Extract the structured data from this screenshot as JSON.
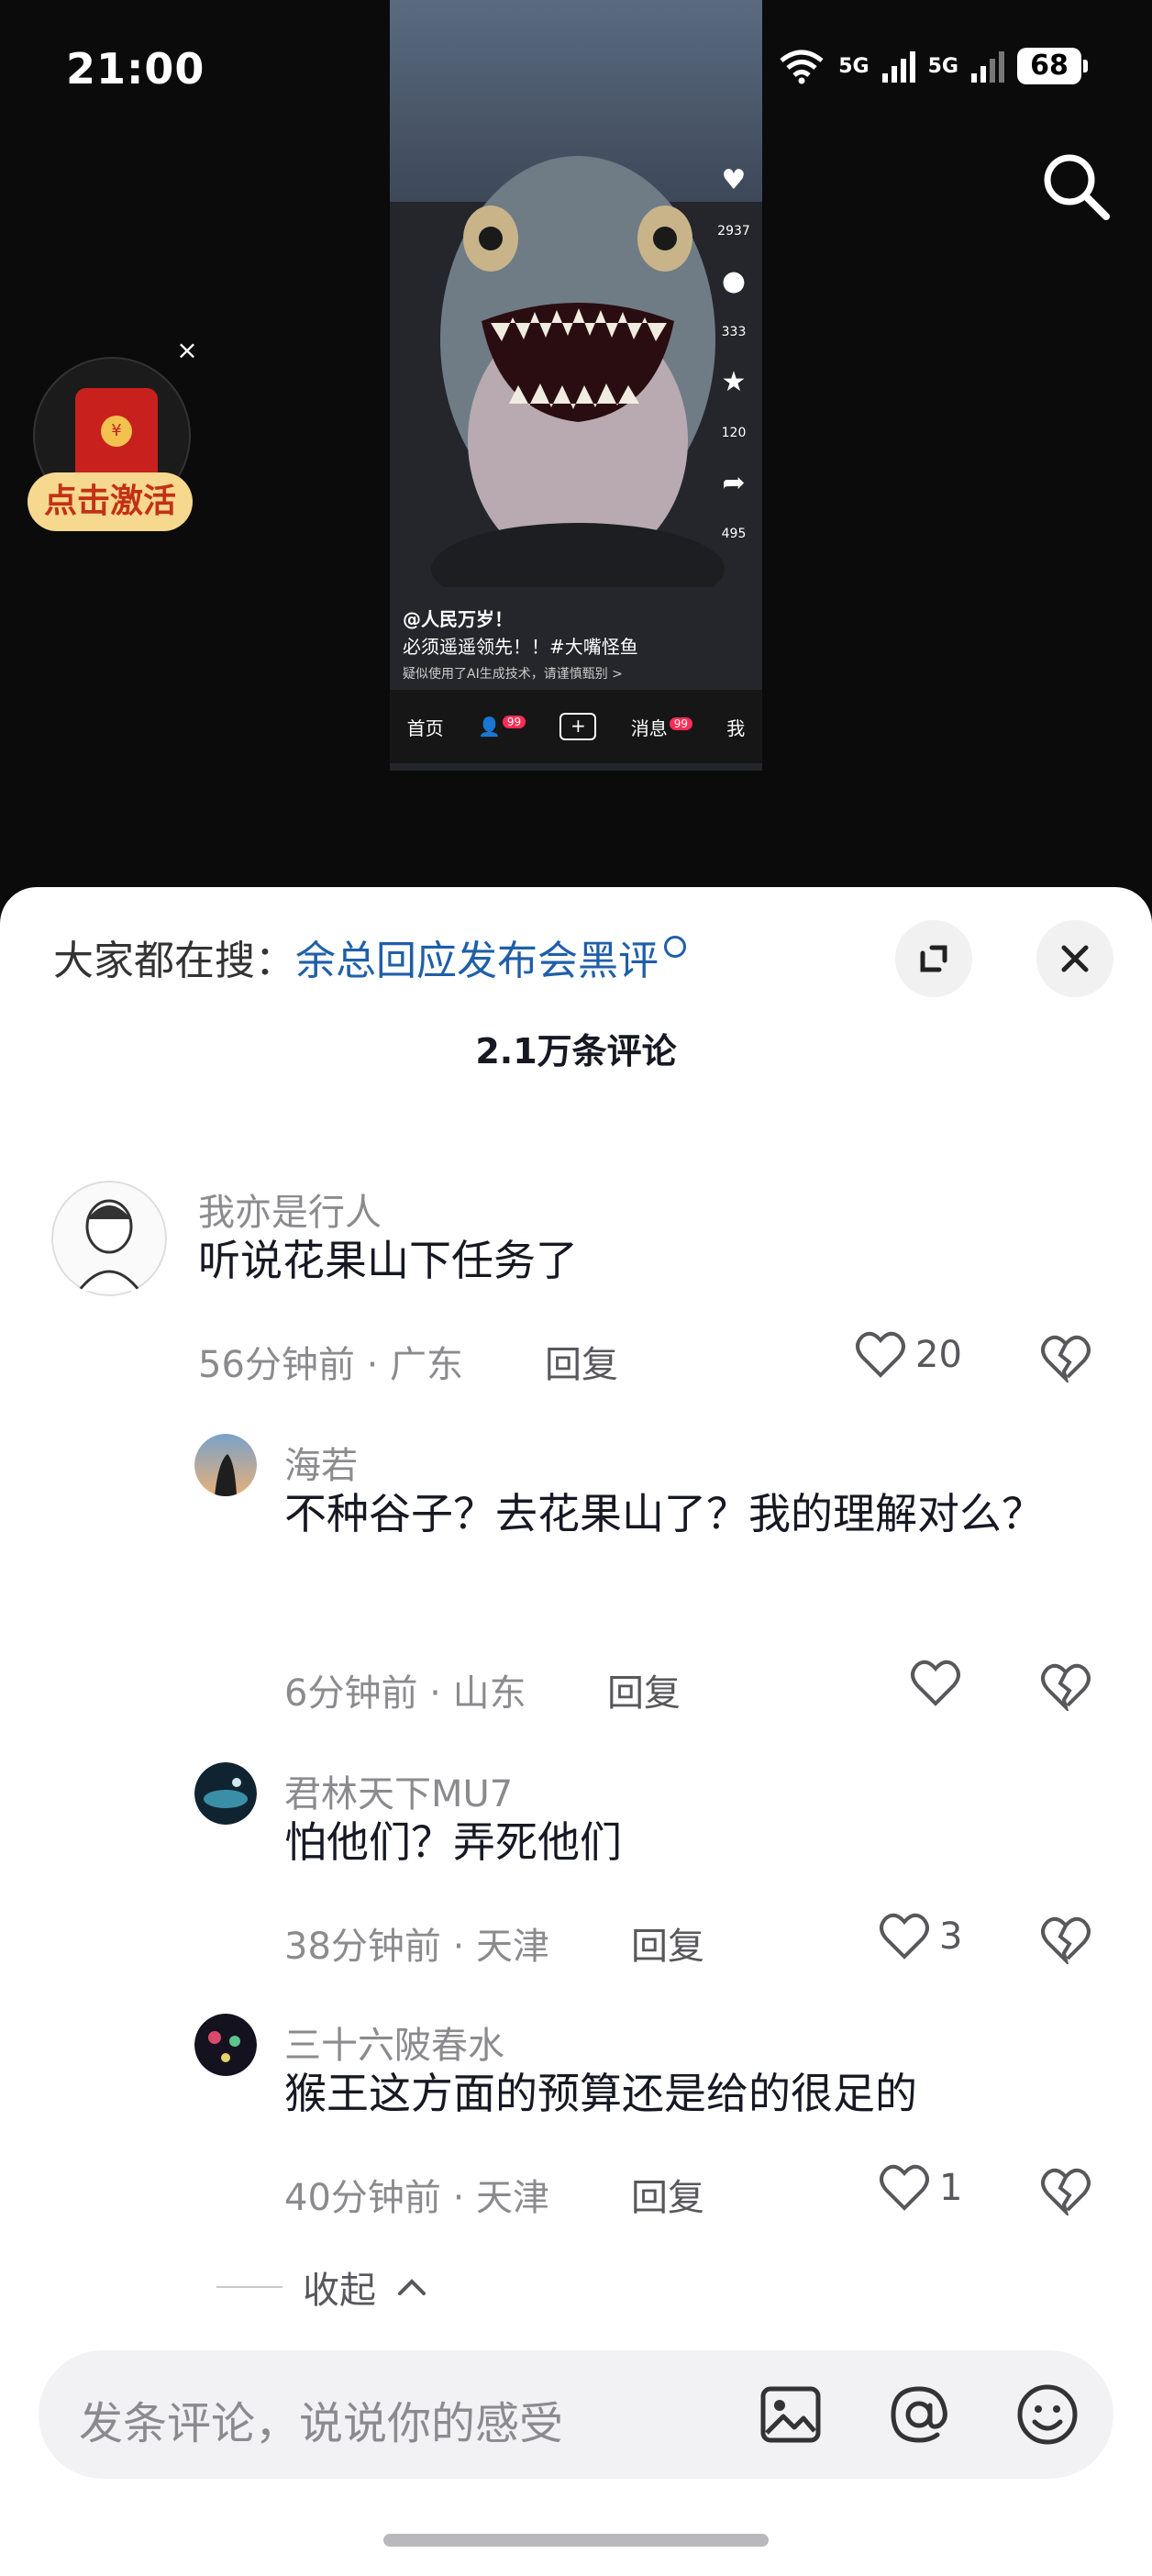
{
  "status_bar": {
    "time": "21:00",
    "network_1": "5G",
    "network_2": "5G",
    "battery": "68"
  },
  "red_packet": {
    "label": "点击激活",
    "close_glyph": "×",
    "seal": "¥"
  },
  "video": {
    "author": "@人民万岁！",
    "caption": "必须遥遥领先！！#大嘴怪鱼",
    "ai_notice": "疑似使用了AI生成技术，请谨慎甄别 >",
    "side_counts": {
      "likes": "2937",
      "comments": "333",
      "favorites": "120",
      "shares": "495"
    },
    "tabs": {
      "home": "首页",
      "badge_1": "99",
      "messages": "消息",
      "badge_2": "99",
      "me": "我"
    }
  },
  "sheet": {
    "hot_search_prefix": "大家都在搜：",
    "hot_search_term": "余总回应发布会黑评",
    "comment_count_title": "2.1万条评论",
    "comments": [
      {
        "name": "我亦是行人",
        "text": "听说花果山下任务了",
        "time": "56分钟前 · 广东",
        "reply": "回复",
        "likes": "20"
      },
      {
        "name": "海若",
        "text": "不种谷子？去花果山了？我的理解对么？",
        "time": "6分钟前 · 山东",
        "reply": "回复",
        "likes": ""
      },
      {
        "name": "君林天下MU7",
        "text": "怕他们？弄死他们",
        "time": "38分钟前 · 天津",
        "reply": "回复",
        "likes": "3"
      },
      {
        "name": "三十六陂春水",
        "text": "猴王这方面的预算还是给的很足的",
        "time": "40分钟前 · 天津",
        "reply": "回复",
        "likes": "1"
      }
    ],
    "collapse_label": "收起",
    "input_placeholder": "发条评论，说说你的感受"
  }
}
